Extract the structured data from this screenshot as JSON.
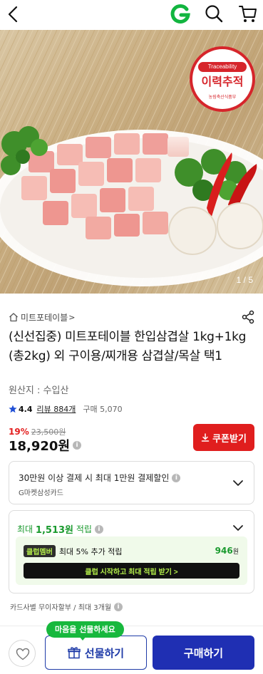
{
  "header": {
    "back_icon": "chevron-left-icon",
    "logo_icon": "g-logo-icon",
    "search_icon": "search-icon",
    "cart_icon": "cart-icon",
    "logo_color": "#12b53f"
  },
  "hero": {
    "badge_top": "Traceability",
    "badge_main": "이력추적",
    "badge_sub": "농림축산식품부",
    "pager": "1 / 5"
  },
  "seller": {
    "name": "미트포테이블",
    "chevron": ">"
  },
  "product": {
    "title": "(신선집중) 미트포테이블 한입삼겹살 1kg+1kg (총2kg) 외 구이용/찌개용 삼겹살/목살 택1",
    "origin": "원산지 : 수입산",
    "rating": "4.4",
    "review_label": "리뷰 884개",
    "purchase_count": "구매 5,070",
    "discount_rate": "19%",
    "original_price": "23,500원",
    "sale_price": "18,920원"
  },
  "coupon": {
    "label": "쿠폰받기",
    "color": "#e01e1e"
  },
  "card_discount": {
    "line1": "30만원 이상 결제 시 최대 1만원 결제할인",
    "line2": "G마켓삼성카드"
  },
  "points": {
    "prefix": "최대",
    "amount": "1,513원",
    "suffix": "적립",
    "club_badge": "클럽멤버",
    "club_text": "최대 5% 추가 적립",
    "club_amount": "946",
    "club_unit": "원",
    "club_button": "클럽 시작하고 최대 적립 받기 >"
  },
  "installment": "카드사별 무이자할부 / 최대 3개월",
  "bottom": {
    "tooltip": "마음을 선물하세요",
    "gift_label": "선물하기",
    "buy_label": "구매하기",
    "accent": "#1f2fb3",
    "tooltip_color": "#17b83d"
  }
}
